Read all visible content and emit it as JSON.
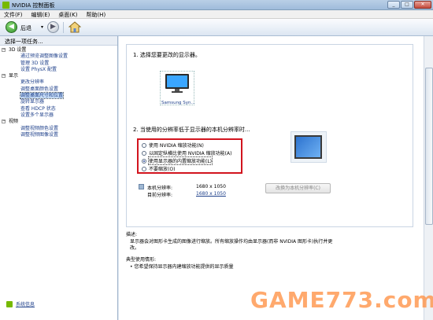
{
  "window": {
    "title": "NVIDIA 控制面板",
    "buttons": [
      "_",
      "□",
      "✕"
    ]
  },
  "menu": [
    "文件(F)",
    "编辑(E)",
    "桌面(K)",
    "帮助(H)"
  ],
  "toolbar": {
    "back_label": "后退",
    "back_dropdown": "▾"
  },
  "left_panel": {
    "header": "选择一项任务...",
    "tree": [
      {
        "type": "cat",
        "label": "3D 设置"
      },
      {
        "type": "leaf",
        "label": "通过预览调整图像设置"
      },
      {
        "type": "leaf",
        "label": "管理 3D 设置"
      },
      {
        "type": "leaf",
        "label": "设置 PhysX 配置"
      },
      {
        "type": "cat",
        "label": "显示"
      },
      {
        "type": "leaf",
        "label": "更改分辨率"
      },
      {
        "type": "leaf",
        "label": "调整桌面颜色设置"
      },
      {
        "type": "leaf",
        "label": "调整桌面尺寸和位置",
        "selected": true
      },
      {
        "type": "leaf",
        "label": "旋转显示器"
      },
      {
        "type": "leaf",
        "label": "查看 HDCP 状态"
      },
      {
        "type": "leaf",
        "label": "设置多个显示器"
      },
      {
        "type": "cat",
        "label": "视频"
      },
      {
        "type": "leaf",
        "label": "调整视频颜色设置"
      },
      {
        "type": "leaf",
        "label": "调整视频图像设置"
      }
    ],
    "system_info": "系统信息"
  },
  "main": {
    "step1": "1. 选择您要更改的显示器。",
    "monitor_label": "Samsung Syn...",
    "step2": "2. 当使用的分辨率低于显示器的本机分辨率时...",
    "options": [
      {
        "label": "使用 NVIDIA 缩放功能(N)",
        "selected": false
      },
      {
        "label": "以固定纵横比使用 NVIDIA 缩放功能(A)",
        "selected": false
      },
      {
        "label": "使用显示器的内置缩放功能(L)",
        "selected": true
      },
      {
        "label": "不要缩放(O)",
        "selected": false
      }
    ],
    "native_res_label": "本机分辨率:",
    "native_res_value": "1680 x 1050",
    "current_res_label": "目前分辨率:",
    "current_res_value": "1680 x 1050",
    "change_button": "改换为本机分辨率(C)",
    "description_title": "描述:",
    "description_lines": [
      "显示器会对图形卡生成的图像进行缩放。所有缩放操作均由显示器(而非 NVIDIA 图形卡)执行并更",
      "改。"
    ],
    "usage_title": "典型使用情形:",
    "usage_items": [
      "• 您希望保持显示器内建缩放功能提供的显示质量"
    ]
  },
  "watermark": "GAME773.com",
  "colors": {
    "accent_red": "#d2141e",
    "link_blue": "#1d3f8a",
    "nvidia_green": "#76b900"
  }
}
